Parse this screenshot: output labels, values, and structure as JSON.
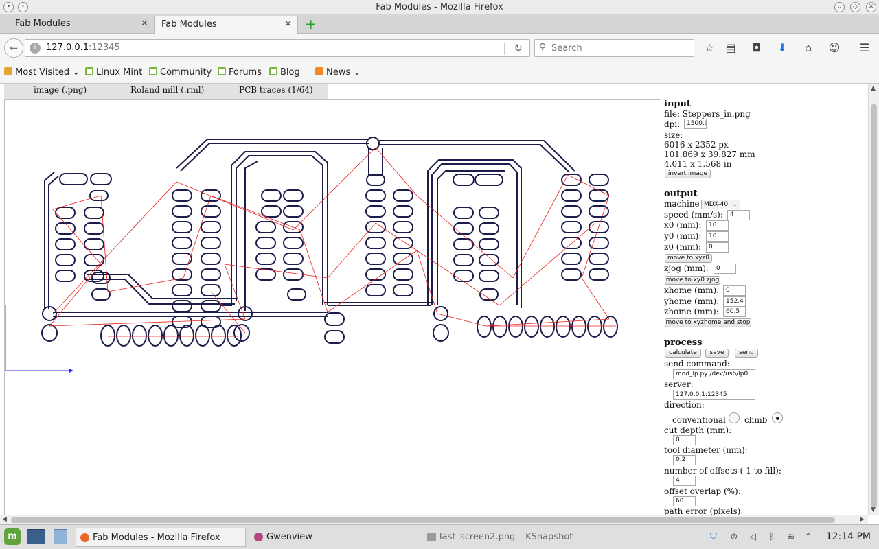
{
  "window": {
    "title": "Fab Modules - Mozilla Firefox"
  },
  "tabs": [
    {
      "label": "Fab Modules"
    },
    {
      "label": "Fab Modules"
    }
  ],
  "nav": {
    "url_host": "127.0.0.1",
    "url_port": ":12345",
    "search_placeholder": "Search"
  },
  "bookmarks": [
    {
      "label": "Most Visited",
      "icon": "folder-icon"
    },
    {
      "label": "Linux Mint",
      "icon": "mint-icon"
    },
    {
      "label": "Community",
      "icon": "mint-icon"
    },
    {
      "label": "Forums",
      "icon": "mint-icon"
    },
    {
      "label": "Blog",
      "icon": "mint-icon"
    },
    {
      "label": "News",
      "icon": "rss-icon"
    }
  ],
  "page": {
    "menu": [
      "image (.png)",
      "Roland mill (.rml)",
      "PCB traces (1/64)"
    ]
  },
  "panel": {
    "input": {
      "heading": "input",
      "file": "file: Steppers_in.png",
      "dpi_label": "dpi:",
      "dpi_value": "1500.0",
      "size_label": "size:",
      "size_px": "6016 x 2352 px",
      "size_mm": "101.869 x 39.827 mm",
      "size_in": "4.011 x 1.568 in",
      "invert_button": "invert image"
    },
    "output": {
      "heading": "output",
      "machine_label": "machine",
      "machine_value": "MDX-40",
      "speed_label": "speed (mm/s):",
      "speed_value": "4",
      "x0_label": "x0 (mm):",
      "x0_value": "10",
      "y0_label": "y0 (mm):",
      "y0_value": "10",
      "z0_label": "z0 (mm):",
      "z0_value": "0",
      "move_xyz0_button": "move to xyz0",
      "zjog_label": "zjog (mm):",
      "zjog_value": "0",
      "move_xy0_button": "move to xy0 zjog",
      "xhome_label": "xhome (mm):",
      "xhome_value": "0",
      "yhome_label": "yhome (mm):",
      "yhome_value": "152.4",
      "zhome_label": "zhome (mm):",
      "zhome_value": "60.5",
      "move_home_button": "move to xyzhome and stop"
    },
    "process": {
      "heading": "process",
      "calculate_button": "calculate",
      "save_button": "save",
      "send_button": "send",
      "send_command_label": "send command:",
      "send_command_value": "mod_lp.py /dev/usb/lp0",
      "server_label": "server:",
      "server_value": "127.0.0.1:12345",
      "direction_label": "direction:",
      "conventional_label": "conventional",
      "climb_label": "climb",
      "direction_selected": "climb",
      "cut_depth_label": "cut depth (mm):",
      "cut_depth_value": "0",
      "tool_diameter_label": "tool diameter (mm):",
      "tool_diameter_value": "0.2",
      "offsets_label": "number of offsets (-1 to fill):",
      "offsets_value": "4",
      "overlap_label": "offset overlap (%):",
      "overlap_value": "60",
      "path_error_label": "path error (pixels):"
    }
  },
  "taskbar": {
    "tasks": [
      {
        "label": "Fab Modules - Mozilla Firefox",
        "active": true
      },
      {
        "label": "Gwenview",
        "active": false
      },
      {
        "label": "last_screen2.png – KSnapshot",
        "active": false
      }
    ],
    "clock": "12:14 PM"
  },
  "colors": {
    "trace": "#1c1c4a",
    "move_path": "#e8231f",
    "axis_x": "#2a2aff",
    "axis_y": "#1a9a1a"
  }
}
